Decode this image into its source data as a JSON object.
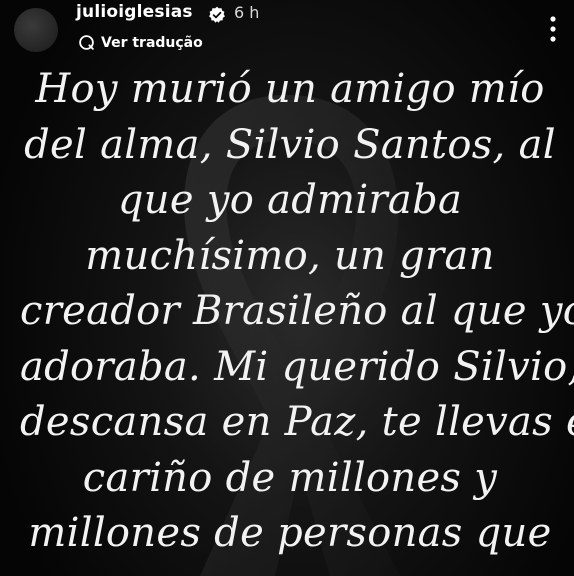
{
  "story": {
    "username": "julioiglesias",
    "time": "6 h",
    "translate_label": "Ver tradução",
    "text_lines": [
      "Hoy murió un amigo mío",
      "del alma, Silvio Santos, al",
      "que yo admiraba",
      "muchísimo, un gran",
      "creador Brasileño al que yo",
      "adoraba. Mi querido Silvio,",
      "descansa en Paz, te llevas el",
      "cariño de millones y",
      "millones de personas que"
    ]
  },
  "colors": {
    "background": "#0a0a0a",
    "text": "#f2f2f2",
    "verified": "#ffffff"
  },
  "icons": {
    "verified": "verified-badge-icon",
    "translate": "translate-icon",
    "menu": "more-options-icon"
  }
}
